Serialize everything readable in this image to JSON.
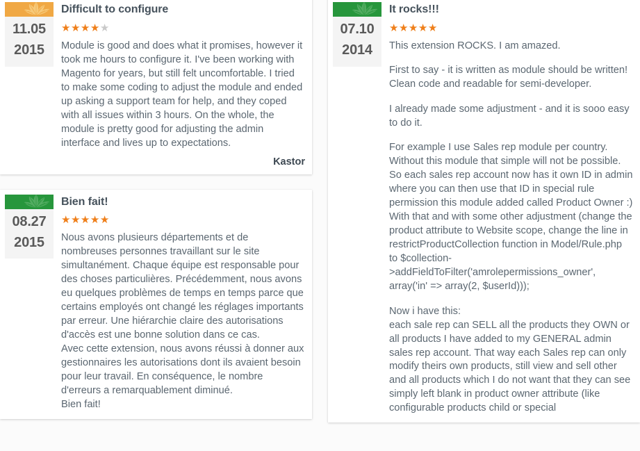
{
  "theme": {
    "star_on_color": "#ef7f1a",
    "star_off_color": "#c9c9c9",
    "badge_orange": "#f0a844",
    "badge_green": "#27963c",
    "title_color": "#46525c",
    "text_color": "#5b6771",
    "card_background": "#ffffff",
    "page_background": "#fbfbfb",
    "date_badge_background": "#f4f4f4"
  },
  "reviews": [
    {
      "id": "review-difficult-to-configure",
      "column": "left",
      "badge_color": "#f0a844",
      "badge_icon": "leaf-icon",
      "date_day": "11.05",
      "date_year": "2015",
      "title": "Difficult to configure",
      "rating": 4,
      "rating_max": 5,
      "paragraphs": [
        "Module is good and does what it promises, however it took me hours to configure it. I've been working with Magento for years, but still felt uncomfortable. I tried to make some coding to adjust the module and ended up asking a support team for help, and they coped with all issues within 3 hours. On the whole, the module is pretty good for adjusting the admin interface and lives up to expectations."
      ],
      "author": "Kastor"
    },
    {
      "id": "review-bien-fait",
      "column": "left",
      "badge_color": "#27963c",
      "badge_icon": "leaf-icon",
      "date_day": "08.27",
      "date_year": "2015",
      "title": "Bien fait!",
      "rating": 5,
      "rating_max": 5,
      "paragraphs": [
        "Nous avons plusieurs départements et de nombreuses personnes travaillant sur le site simultanément. Chaque équipe est responsable pour des choses particulières. Précédemment, nous avons eu quelques problèmes de temps en temps parce que certains employés ont changé les réglages importants par erreur. Une hiérarchie claire des autorisations d'accès est une bonne solution dans ce cas.",
        "Avec cette extension, nous avons réussi à donner aux gestionnaires les autorisations dont ils avaient besoin pour leur travail. En conséquence, le nombre d'erreurs a remarquablement diminué.",
        "Bien fait!"
      ],
      "author": ""
    },
    {
      "id": "review-it-rocks",
      "column": "right",
      "badge_color": "#27963c",
      "badge_icon": "leaf-icon",
      "date_day": "07.10",
      "date_year": "2014",
      "title": "It rocks!!!",
      "rating": 5,
      "rating_max": 5,
      "paragraphs": [
        "This extension ROCKS. I am amazed.",
        "First to say - it is written as module should be written! Clean code and readable for semi-developer.",
        "I already made some adjustment - and it is sooo easy to do it.",
        "For example I use Sales rep module per country. Without this module that simple will not be possible. So each sales rep account now has it own ID in admin where you can then use that ID in special rule permission this module added called Product Owner :) With that and with some other adjustment (change the product attribute to Website scope, change the line in restrictProductCollection function in Model/Rule.php to $collection->addFieldToFilter('amrolepermissions_owner', array('in' => array(2, $userId)));",
        "Now i have this:",
        "each sale rep can SELL all the products they OWN or all products I have added to my GENERAL admin sales rep account. That way each Sales rep can only modify theirs own products, still view and sell other and all products which I do not want that they can see simply left blank in product owner attribute (like configurable products child or special"
      ],
      "author": ""
    }
  ]
}
